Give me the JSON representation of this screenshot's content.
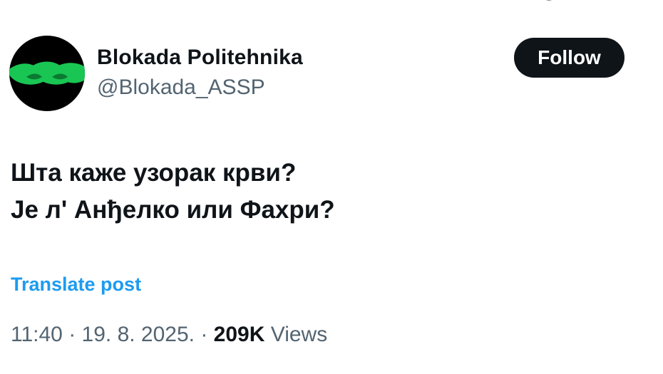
{
  "colors": {
    "text_primary": "#0f1419",
    "text_secondary": "#536471",
    "link": "#1d9bf0",
    "follow_bg": "#0f1419",
    "follow_text": "#ffffff",
    "avatar_bg": "#000000",
    "avatar_logo": "#19c653"
  },
  "icons": {
    "top_fragment": "more-icon",
    "avatar": "green-links-logo"
  },
  "author": {
    "display_name": "Blokada Politehnika",
    "handle": "@Blokada_ASSP"
  },
  "follow_label": "Follow",
  "post": {
    "lines": [
      "Шта каже узорак крви?",
      "Је л' Анђелко или Фахри?"
    ]
  },
  "translate_label": "Translate post",
  "meta": {
    "time": "11:40",
    "separator1": " · ",
    "date": "19. 8. 2025.",
    "separator2": " · ",
    "views_count": "209K",
    "views_label": " Views"
  }
}
